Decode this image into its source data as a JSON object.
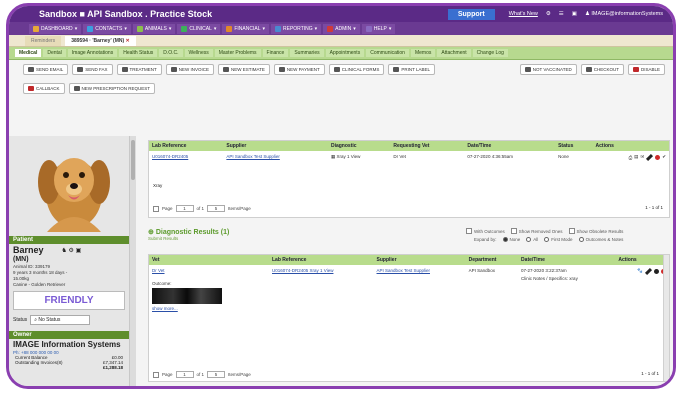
{
  "app": {
    "title": "Sandbox  ■ API Sandbox . Practice Stock",
    "support_label": "Support",
    "toplinks": [
      "What's New",
      "⚙",
      "☰",
      "▣",
      "♟ IMAGE@informationSystems"
    ]
  },
  "nav": [
    {
      "label": "DASHBOARD",
      "color": "#e7a838"
    },
    {
      "label": "CONTACTS",
      "color": "#3aa0e0"
    },
    {
      "label": "ANIMALS",
      "color": "#8cc04c"
    },
    {
      "label": "CLINICAL",
      "color": "#3cb05a"
    },
    {
      "label": "FINANCIAL",
      "color": "#e0882a"
    },
    {
      "label": "REPORTING",
      "color": "#4a8ad0"
    },
    {
      "label": "ADMIN",
      "color": "#d03a3a"
    },
    {
      "label": "HELP",
      "color": "#8a6ac0"
    }
  ],
  "record_tabs": [
    {
      "label": "Reminders"
    },
    {
      "label": "389594 · 'Barney' (MN)"
    }
  ],
  "sub_tabs": [
    "Medical",
    "Dental",
    "Image Annotations",
    "Health Status",
    "D.O.C.",
    "Wellness",
    "Master Problems",
    "Finance",
    "Summaries",
    "Appointments",
    "Communication",
    "Memos",
    "Attachment",
    "Change Log"
  ],
  "toolbar_buttons": [
    "SEND EMAIL",
    "SEND FAX",
    "TREATMENT",
    "NEW INVOICE",
    "NEW ESTIMATE",
    "NEW PAYMENT",
    "CLINICAL FORMS",
    "PRINT LABEL",
    "CALLBACK",
    "NEW PRESCRIPTION REQUEST"
  ],
  "toolbar_right": [
    "NOT VACCINATED",
    "CHECKOUT",
    "DISABLE"
  ],
  "patient": {
    "section_label": "Patient",
    "name": "Barney",
    "sex": "(MN)",
    "id_line": "Animal ID: 339179",
    "age_line": "9 years 3 months 18 days -",
    "weight_line": "15.00kg",
    "breed_line": "Canine - Golden Retriever",
    "temperament": "FRIENDLY",
    "status_label": "Status",
    "status_value": "No Status"
  },
  "owner": {
    "section_label": "Owner",
    "name": "IMAGE Information Systems",
    "phone": "Ph: +88 000 000 00 00",
    "balance_label": "Current Balance",
    "balance_value": "£0.00",
    "outstanding_label": "Outstanding Invoices(8)",
    "outstanding_value": "£7,347.14",
    "total_value": "£1,288.18"
  },
  "lab_table": {
    "headers": [
      "Lab Reference",
      "Supplier",
      "Diagnostic",
      "Requesting Vet",
      "Date/Time",
      "Status",
      "Actions"
    ],
    "rows": [
      {
        "ref": "U016074-DR2405",
        "supplier": "API Sandbox Test Supplier",
        "diagnostic": "Xray 1 View",
        "vet": "Dr Vet",
        "datetime": "07-27-2020 4:36:55am",
        "status": "None"
      }
    ],
    "note": "Xray",
    "pager": {
      "page_label": "Page",
      "page": "1",
      "of_label": "of 1",
      "per_page": "5",
      "per_page_label": "Items/Page",
      "range": "1 - 1 of 1"
    }
  },
  "diag_results": {
    "title": "Diagnostic Results (1)",
    "subtitle": "Submit Results",
    "filters": [
      "With Outcomes",
      "Show Removed Ones",
      "Show Obsolete Results"
    ],
    "expand_label": "Expand by:",
    "expand_options": [
      "None",
      "All",
      "First Mode",
      "Outcomes & Notes"
    ],
    "headers": [
      "Vet",
      "Lab Reference",
      "Supplier",
      "Department",
      "Date/Time",
      "Actions"
    ],
    "rows": [
      {
        "vet": "Dr Vet",
        "ref": "U016074-DR2405 Xray 1 View",
        "supplier": "API Sandbox Test Supplier",
        "department": "API Sandbox",
        "datetime": "07-27-2020 3:22:37am",
        "notes": "Clinic Notes / Specifics: xray",
        "outcome_label": "Outcome:",
        "show_more": "show more..."
      }
    ],
    "pager": {
      "page_label": "Page",
      "page": "1",
      "of_label": "of 1",
      "per_page": "5",
      "per_page_label": "Items/Page",
      "range": "1 - 1 of 1"
    }
  },
  "colors": {
    "accent": "#5b2a86",
    "green": "#b8dc8c",
    "frame": "#8a3fb0"
  }
}
